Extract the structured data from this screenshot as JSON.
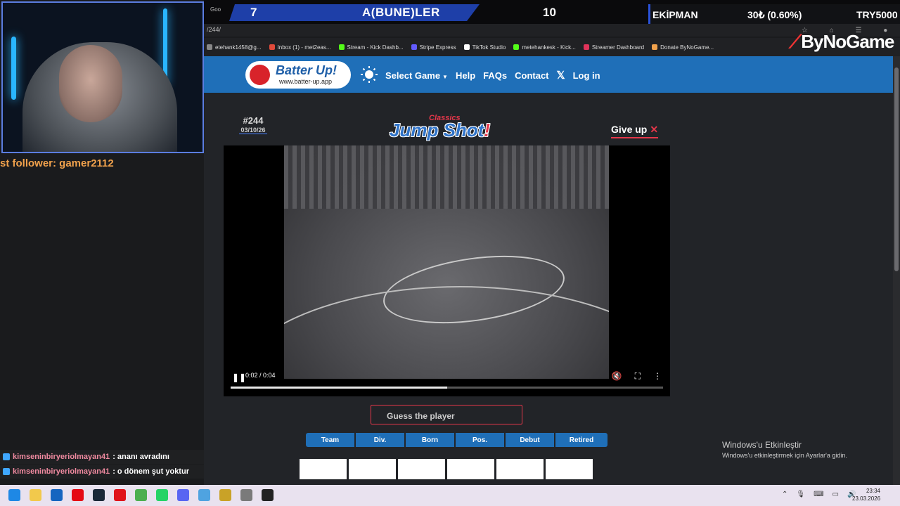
{
  "overlay": {
    "score_left": "7",
    "score_title": "A(BUNE)LER",
    "score_right": "10",
    "ekipman_label": "EKİPMAN",
    "ekipman_value": "30₺ (0.60%)",
    "ekipman_currency": "TRY5000",
    "follower": "st follower: gamer2112",
    "brand": "ByNoGame"
  },
  "browser": {
    "tab_fragment": "Goo",
    "url": "/244/",
    "bookmarks": [
      {
        "label": "etehank1458@g...",
        "color": "#888888"
      },
      {
        "label": "Inbox (1) - met2eas...",
        "color": "#e04a3a"
      },
      {
        "label": "Stream - Kick Dashb...",
        "color": "#53fc18"
      },
      {
        "label": "Stripe Express",
        "color": "#635bff"
      },
      {
        "label": "TikTok Studio",
        "color": "#ffffff"
      },
      {
        "label": "metehankesk - Kick...",
        "color": "#53fc18"
      },
      {
        "label": "Streamer Dashboard",
        "color": "#e0335a"
      },
      {
        "label": "Donate ByNoGame...",
        "color": "#f0a14c"
      }
    ]
  },
  "site": {
    "logo_name": "Batter Up!",
    "logo_url": "www.batter-up.app",
    "nav": {
      "select_game": "Select Game",
      "help": "Help",
      "faqs": "FAQs",
      "contact": "Contact",
      "login": "Log in"
    },
    "game_number": "#244",
    "game_date": "03/10/26",
    "title_small": "Classics",
    "title_big": "Jump Shot",
    "title_bang": "!",
    "give_up": "Give up"
  },
  "video": {
    "time": "0:02 / 0:04",
    "progress_fraction": 0.5
  },
  "guess": {
    "placeholder": "Guess the player",
    "columns": [
      "Team",
      "Div.",
      "Born",
      "Pos.",
      "Debut",
      "Retired"
    ]
  },
  "chat": [
    {
      "user": "kimseninbiryeriolmayan41",
      "message": " : ananı avradını"
    },
    {
      "user": "kimseninbiryeriolmayan41",
      "message": " : o dönem şut yoktur"
    }
  ],
  "windows": {
    "activate_title": "Windows'u Etkinleştir",
    "activate_sub": "Windows'u etkinleştirmek için Ayarlar'a gidin.",
    "clock_time": "23:34",
    "clock_date": "23.03.2026"
  },
  "taskbar_icons": [
    {
      "name": "windows-start-icon",
      "color": "#1e88e5"
    },
    {
      "name": "file-explorer-icon",
      "color": "#f2c94c"
    },
    {
      "name": "store-icon",
      "color": "#1565c0"
    },
    {
      "name": "netflix-icon",
      "color": "#e50914"
    },
    {
      "name": "steam-icon",
      "color": "#1b2838"
    },
    {
      "name": "opera-icon",
      "color": "#e0131b"
    },
    {
      "name": "chrome-icon",
      "color": "#4caf50"
    },
    {
      "name": "whatsapp-icon",
      "color": "#25d366"
    },
    {
      "name": "discord-icon",
      "color": "#5865f2"
    },
    {
      "name": "network-app-icon",
      "color": "#4fa3e0"
    },
    {
      "name": "game-app-icon",
      "color": "#c9a227"
    },
    {
      "name": "settings-icon",
      "color": "#7a7a7a"
    },
    {
      "name": "record-app-icon",
      "color": "#222222"
    }
  ]
}
